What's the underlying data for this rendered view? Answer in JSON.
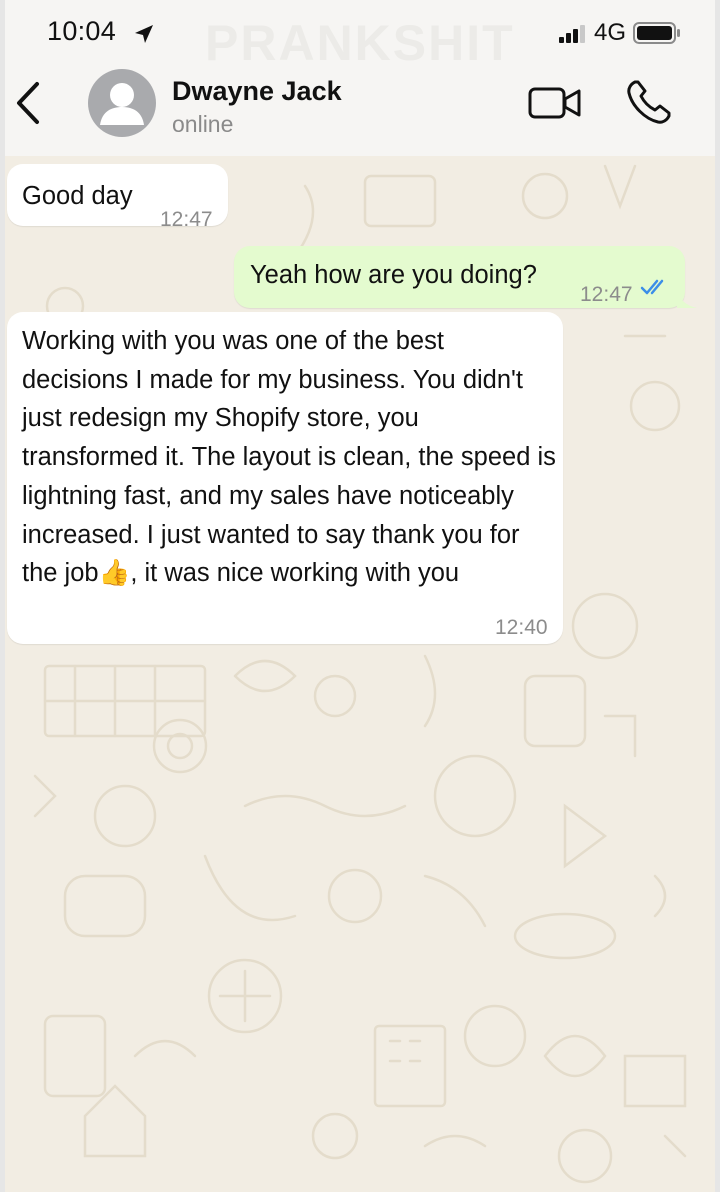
{
  "status_bar": {
    "time": "10:04",
    "network": "4G",
    "watermark": "PRANKSHIT"
  },
  "header": {
    "contact_name": "Dwayne Jack",
    "contact_status": "online"
  },
  "messages": [
    {
      "direction": "incoming",
      "text": "Good day",
      "time": "12:47"
    },
    {
      "direction": "outgoing",
      "text": "Yeah how are you doing?",
      "time": "12:47",
      "read": true
    },
    {
      "direction": "incoming",
      "text": "Working with you was one of the best decisions I made for my business. You didn't just redesign my Shopify store, you transformed it. The layout is clean, the speed is lightning fast, and my sales have noticeably increased. I just wanted to say thank you for the job👍, it was nice working with you",
      "time": "12:40"
    }
  ],
  "colors": {
    "chat_background": "#f2ede3",
    "outgoing_bubble": "#e4fbcf",
    "incoming_bubble": "#ffffff",
    "read_ticks": "#3b8ee8"
  },
  "icons": {
    "back": "chevron-left-icon",
    "video": "video-camera-icon",
    "phone": "phone-icon",
    "ticks": "double-check-icon"
  }
}
